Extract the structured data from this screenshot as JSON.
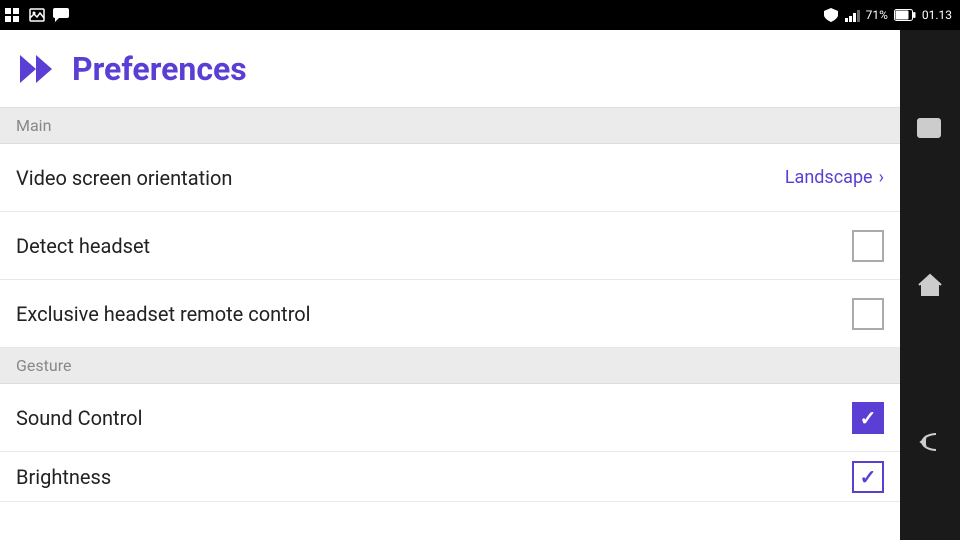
{
  "statusBar": {
    "battery": "71%",
    "time": "01.13",
    "icons": [
      "grid-icon",
      "image-icon",
      "bbm-icon"
    ]
  },
  "header": {
    "title": "Preferences",
    "iconAlt": "preferences-icon"
  },
  "sections": [
    {
      "id": "main",
      "label": "Main",
      "items": [
        {
          "id": "video-orientation",
          "label": "Video screen orientation",
          "type": "value",
          "value": "Landscape",
          "hasChevron": true,
          "checked": null
        },
        {
          "id": "detect-headset",
          "label": "Detect headset",
          "type": "checkbox",
          "value": null,
          "checked": false
        },
        {
          "id": "exclusive-headset",
          "label": "Exclusive headset remote control",
          "type": "checkbox",
          "value": null,
          "checked": false
        }
      ]
    },
    {
      "id": "gesture",
      "label": "Gesture",
      "items": [
        {
          "id": "sound-control",
          "label": "Sound Control",
          "type": "checkbox",
          "value": null,
          "checked": true
        },
        {
          "id": "brightness",
          "label": "Brightness",
          "type": "checkbox",
          "value": null,
          "checked": "partial",
          "partial": true
        }
      ]
    }
  ],
  "sidebar": {
    "buttons": [
      "window-icon",
      "home-icon",
      "back-icon"
    ]
  }
}
